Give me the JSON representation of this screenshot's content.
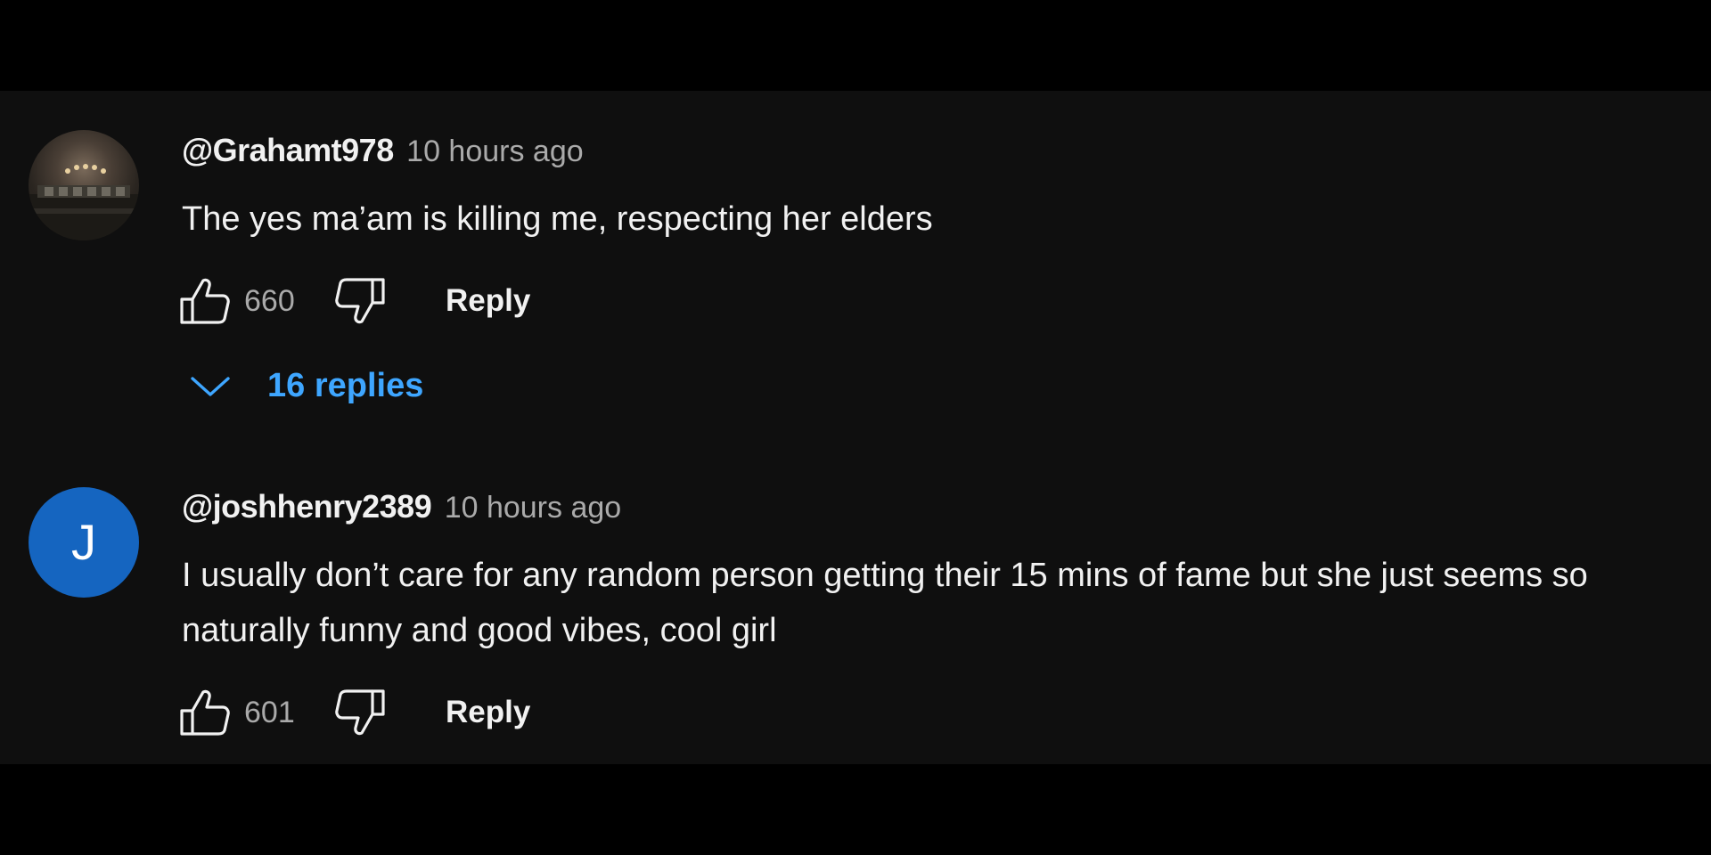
{
  "comments": [
    {
      "author": "@Grahamt978",
      "time": "10 hours ago",
      "text": "The yes ma’am is killing me, respecting her elders",
      "likes": "660",
      "reply_label": "Reply",
      "replies": "16 replies",
      "avatar": {
        "type": "photo",
        "icon": "stadium-photo"
      }
    },
    {
      "author": "@joshhenry2389",
      "time": "10 hours ago",
      "text": "I usually don’t care for any random person getting their 15 mins of fame but she just seems so naturally funny and good vibes, cool girl",
      "likes": "601",
      "reply_label": "Reply",
      "avatar": {
        "type": "letter",
        "letter": "J",
        "color": "#1565c0"
      }
    }
  ],
  "colors": {
    "background": "#0f0f0f",
    "text": "#f1f1f1",
    "muted": "#aaaaaa",
    "link": "#3ea6ff"
  }
}
